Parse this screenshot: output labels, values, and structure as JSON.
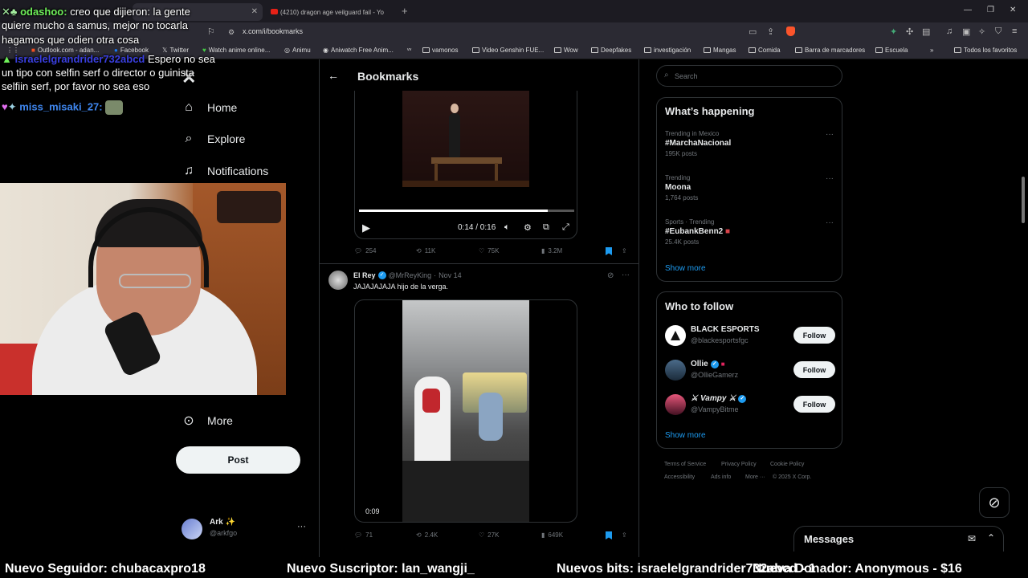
{
  "browser": {
    "tabs": [
      {
        "title": "",
        "active": true
      },
      {
        "title": "(4210) dragon age veilguard fail - Yo",
        "active": false
      }
    ],
    "url": "x.com/i/bookmarks",
    "bookmarks": [
      {
        "label": "Outlook.com - adan..."
      },
      {
        "label": "Facebook"
      },
      {
        "label": "Twitter"
      },
      {
        "label": "Watch anime online..."
      },
      {
        "label": "Animu"
      },
      {
        "label": "Aniwatch Free Anim..."
      },
      {
        "label": "vamonos"
      },
      {
        "label": "Video Genshin FUE..."
      },
      {
        "label": "Wow"
      },
      {
        "label": "Deepfakes"
      },
      {
        "label": "investigación"
      },
      {
        "label": "Mangas"
      },
      {
        "label": "Comida"
      },
      {
        "label": "Barra de marcadores"
      },
      {
        "label": "Escuela"
      },
      {
        "label": "Todos los favoritos"
      }
    ]
  },
  "chat": {
    "line1_user": "odashoo",
    "line1_text": "creo que dijieron: la gente",
    "line2": "quiere mucho a samus, mejor no tocarla",
    "line3": "hagamos que odien otra cosa",
    "line4_user": "israelelgrandrider732abcd",
    "line4_text": "Espero no sea",
    "line5": "un tipo con selfin serf o director o guinista",
    "line6": "selfiin serf, por favor no sea eso",
    "line7_user": "miss_misaki_27"
  },
  "nav": {
    "home": "Home",
    "explore": "Explore",
    "notifications": "Notifications",
    "more": "More",
    "post": "Post",
    "account_name": "Ark",
    "account_handle": "@arkfgo"
  },
  "main": {
    "title": "Bookmarks",
    "tweet1": {
      "time": "0:14 / 0:16",
      "progress": 0.875,
      "replies": "254",
      "retweets": "11K",
      "likes": "75K",
      "views": "3.2M"
    },
    "tweet2": {
      "name": "El Rey",
      "handle": "@MrReyKing",
      "date": "Nov 14",
      "text": "JAJAJAJAJA hijo de la verga.",
      "duration": "0:09",
      "replies": "71",
      "retweets": "2.4K",
      "likes": "27K",
      "views": "649K"
    }
  },
  "right": {
    "search_placeholder": "Search",
    "happening_title": "What’s happening",
    "trends": [
      {
        "meta": "Trending in Mexico",
        "name": "#MarchaNacional",
        "count": "195K posts"
      },
      {
        "meta": "Trending",
        "name": "Moona",
        "count": "1,764 posts"
      },
      {
        "meta": "Sports · Trending",
        "name": "#EubankBenn2",
        "count": "25.4K posts"
      }
    ],
    "show_more": "Show more",
    "who_title": "Who to follow",
    "who": [
      {
        "name": "BLACK ESPORTS",
        "handle": "@blackesportsfgc"
      },
      {
        "name": "Ollie",
        "handle": "@OllieGamerz"
      },
      {
        "name": "Vampy",
        "handle": "@VampyBitme"
      }
    ],
    "follow_label": "Follow",
    "footer": [
      "Terms of Service",
      "Privacy Policy",
      "Cookie Policy",
      "Accessibility",
      "Ads info",
      "More ···",
      "© 2025 X Corp."
    ],
    "messages": "Messages"
  },
  "ticker": {
    "follower": "Nuevo Seguidor: chubacaxpro18",
    "subscriber": "Nuevo Suscriptor: lan_wangji_",
    "bits": "Nuevos bits: israelelgrandrider732abcd - 1",
    "donation": "Nueva Donador: Anonymous - $16"
  },
  "colors": {
    "accent": "#1d9bf0",
    "background": "#000000",
    "chat_user": "#a970ff"
  }
}
